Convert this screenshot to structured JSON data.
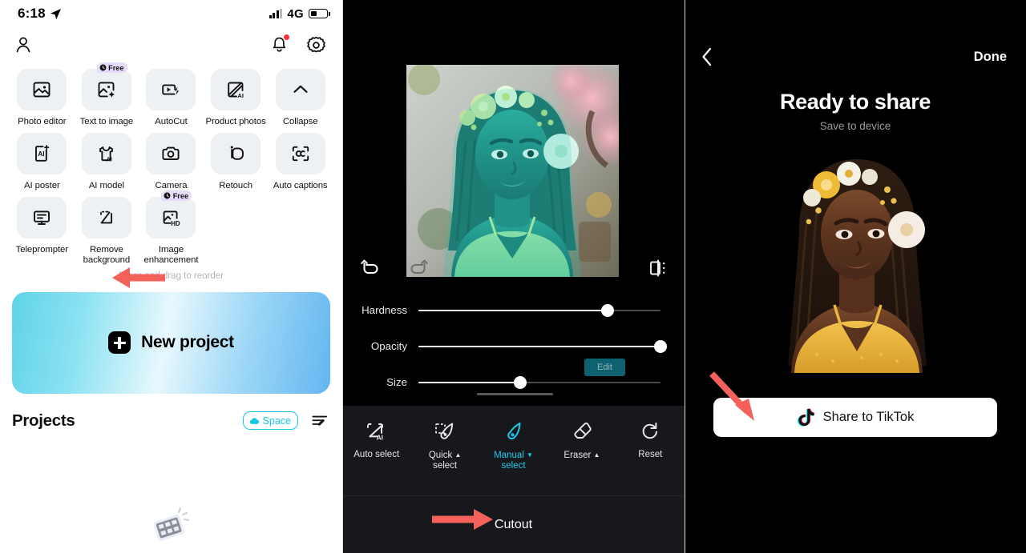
{
  "status_bar": {
    "time": "6:18",
    "location_icon": "location-arrow-icon",
    "network": "4G",
    "signal_icon": "signal-bars-icon",
    "battery_icon": "battery-icon"
  },
  "left_panel": {
    "app_bar": {
      "profile_icon": "profile-icon",
      "notification_icon": "bell-icon",
      "settings_icon": "gear-icon",
      "has_notification_dot": true
    },
    "tools_grid": {
      "rows": [
        [
          {
            "label": "Photo editor",
            "icon": "image-frame-icon",
            "badge": null
          },
          {
            "label": "Text to image",
            "icon": "image-sparkle-icon",
            "badge": "Free"
          },
          {
            "label": "AutoCut",
            "icon": "video-bolt-icon",
            "badge": null
          },
          {
            "label": "Product photos",
            "icon": "ai-diagonal-icon",
            "badge": null
          },
          {
            "label": "Collapse",
            "icon": "chevron-up-icon",
            "badge": null
          }
        ],
        [
          {
            "label": "AI poster",
            "icon": "ai-poster-icon",
            "badge": null
          },
          {
            "label": "AI model",
            "icon": "ai-shirt-icon",
            "badge": null
          },
          {
            "label": "Camera",
            "icon": "camera-icon",
            "badge": null
          },
          {
            "label": "Retouch",
            "icon": "retouch-face-icon",
            "badge": null
          },
          {
            "label": "Auto captions",
            "icon": "captions-icon",
            "badge": null
          }
        ],
        [
          {
            "label": "Teleprompter",
            "icon": "teleprompter-icon",
            "badge": null
          },
          {
            "label": "Remove background",
            "icon": "remove-background-icon",
            "badge": null
          },
          {
            "label": "Image enhancement",
            "icon": "hd-image-icon",
            "badge": "Free"
          }
        ]
      ],
      "reorder_hint": "Press and drag to reorder",
      "badge_clock_icon": "clock-icon"
    },
    "new_project": {
      "label": "New project",
      "icon": "plus-square-icon"
    },
    "projects": {
      "title": "Projects",
      "space_label": "Space",
      "space_icon": "cloud-icon",
      "manage_icon": "edit-list-icon",
      "empty_icon": "film-strip-icon"
    }
  },
  "middle_panel": {
    "top_bar": {
      "undo_icon": "undo-icon",
      "redo_icon": "redo-icon",
      "compare_icon": "compare-split-icon"
    },
    "sliders": [
      {
        "label": "Hardness",
        "value": 78
      },
      {
        "label": "Opacity",
        "value": 100
      },
      {
        "label": "Size",
        "value": 42
      }
    ],
    "edit_tooltip": "Edit",
    "toolbar": [
      {
        "label": "Auto select",
        "icon": "auto-select-ai-icon",
        "active": false,
        "caret": null
      },
      {
        "label": "Quick select",
        "icon": "quick-select-brush-icon",
        "active": false,
        "caret": "up"
      },
      {
        "label": "Manual select",
        "icon": "manual-select-brush-icon",
        "active": true,
        "caret": "down"
      },
      {
        "label": "Eraser",
        "icon": "eraser-icon",
        "active": false,
        "caret": "up"
      },
      {
        "label": "Reset",
        "icon": "reset-icon",
        "active": false,
        "caret": null
      }
    ],
    "bottom_action": "Cutout"
  },
  "right_panel": {
    "back_icon": "chevron-left-icon",
    "done_label": "Done",
    "title": "Ready to share",
    "subtitle": "Save to device",
    "share_button": {
      "label": "Share to TikTok",
      "icon": "tiktok-icon"
    }
  },
  "annotations": {
    "arrow_color": "#f4605a",
    "arrows": [
      {
        "target": "remove-background-tile",
        "direction": "left"
      },
      {
        "target": "cutout-action",
        "direction": "right"
      },
      {
        "target": "share-to-tiktok-button",
        "direction": "down-right"
      }
    ]
  },
  "colors": {
    "accent_cyan": "#1ec8e8",
    "space_cyan": "#17c7e8",
    "tile_bg": "#eef1f4",
    "badge_bg": "#e5ddfb",
    "dark_bg": "#000000",
    "toolbar_bg": "#17181c",
    "edit_tip_bg": "#0e6170",
    "arrow_red": "#f4605a"
  }
}
